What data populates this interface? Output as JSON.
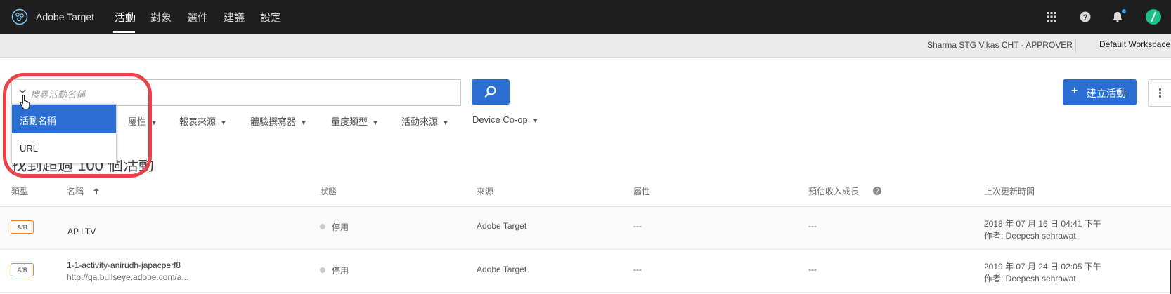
{
  "app": {
    "brand": "Adobe Target",
    "nav_tabs": [
      "活動",
      "對象",
      "選件",
      "建議",
      "設定"
    ],
    "active_tab": "活動"
  },
  "subheader": {
    "user": "Sharma STG Vikas CHT - APPROVER",
    "workspace": "Default Workspace"
  },
  "search": {
    "placeholder": "搜尋活動名稱",
    "dropdown_options": [
      "活動名稱",
      "URL"
    ],
    "selected_option": "活動名稱"
  },
  "toolbar": {
    "create_label": "建立活動",
    "create_icon": "+"
  },
  "filters": [
    "屬性",
    "報表來源",
    "體驗撰寫器",
    "量度類型",
    "活動來源",
    "Device Co-op"
  ],
  "result_count_text": "找到超過 100 個活動",
  "table": {
    "headers": [
      "類型",
      "名稱",
      "狀態",
      "來源",
      "屬性",
      "預估收入成長",
      "上次更新時間"
    ],
    "rows": [
      {
        "type": "A/B",
        "name": "AP LTV",
        "url": "",
        "status": "停用",
        "source": "Adobe Target",
        "property": "---",
        "revenue": "---",
        "updated": "2018 年 07 月 16 日 04:41 下午",
        "author": "作者: Deepesh sehrawat"
      },
      {
        "type": "A/B",
        "name": "1-1-activity-anirudh-japacperf8",
        "url": "http://qa.bullseye.adobe.com/a...",
        "status": "停用",
        "source": "Adobe Target",
        "property": "---",
        "revenue": "---",
        "updated": "2019 年 07 月 24 日 02:05 下午",
        "author": "作者: Deepesh sehrawat"
      }
    ]
  },
  "colors": {
    "topnav_bg": "#1e1e1e",
    "primary_blue": "#2b6ed1",
    "badge_orange": "#f08232",
    "highlight_red": "#e9434a",
    "avatar_green": "#1fbf8a"
  },
  "icons": {
    "logo": "adobe-target-logo-icon",
    "apps": "grid-icon",
    "help": "help-icon",
    "notifications": "bell-icon",
    "avatar": "avatar-icon",
    "search": "search-icon",
    "more": "more-vertical-icon",
    "sort": "sort-up-arrow-icon"
  }
}
